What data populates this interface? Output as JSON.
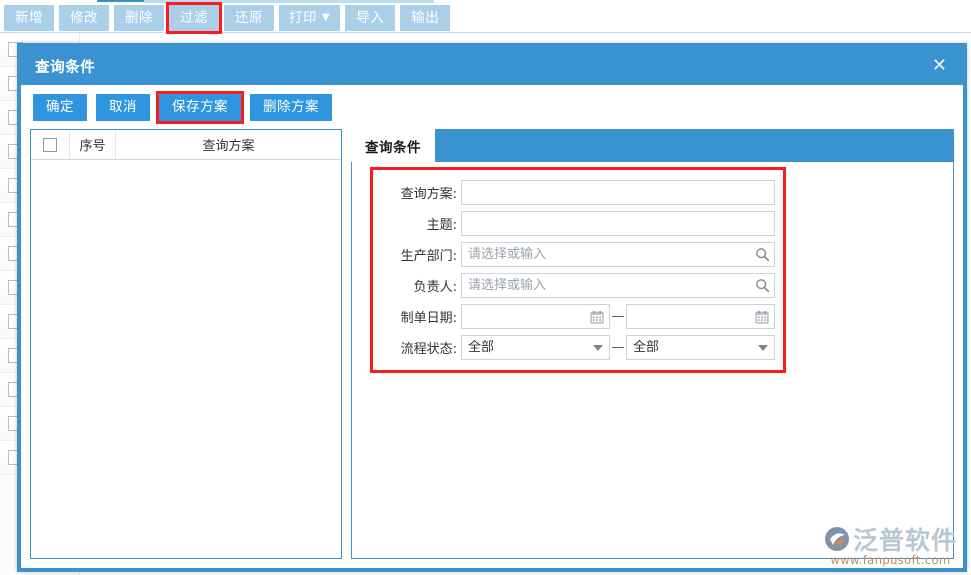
{
  "background": {
    "toolbar": {
      "buttons": [
        {
          "label": "新增",
          "name": "add-button",
          "highlighted": false,
          "caret": false
        },
        {
          "label": "修改",
          "name": "edit-button",
          "highlighted": false,
          "caret": false
        },
        {
          "label": "删除",
          "name": "delete-button",
          "highlighted": false,
          "caret": false
        },
        {
          "label": "过滤",
          "name": "filter-button",
          "highlighted": true,
          "caret": false
        },
        {
          "label": "还原",
          "name": "restore-button",
          "highlighted": false,
          "caret": false
        },
        {
          "label": "打印",
          "name": "print-button",
          "highlighted": false,
          "caret": true
        },
        {
          "label": "导入",
          "name": "import-button",
          "highlighted": false,
          "caret": false
        },
        {
          "label": "输出",
          "name": "export-button",
          "highlighted": false,
          "caret": false
        }
      ]
    },
    "grid_row_count": 13
  },
  "dialog": {
    "title": "查询条件",
    "close_icon": "close-icon",
    "toolbar": [
      {
        "label": "确定",
        "name": "confirm-button",
        "highlighted": false
      },
      {
        "label": "取消",
        "name": "cancel-button",
        "highlighted": false
      },
      {
        "label": "保存方案",
        "name": "save-scheme-button",
        "highlighted": true
      },
      {
        "label": "删除方案",
        "name": "delete-scheme-button",
        "highlighted": false
      }
    ],
    "scheme_table": {
      "columns": [
        "",
        "序号",
        "查询方案"
      ],
      "rows": []
    },
    "tabs": [
      {
        "label": "查询条件",
        "active": true
      }
    ],
    "form": {
      "fields": [
        {
          "type": "text",
          "label": "查询方案:",
          "name": "query-scheme-field",
          "value": "",
          "placeholder": ""
        },
        {
          "type": "text",
          "label": "主题:",
          "name": "subject-field",
          "value": "",
          "placeholder": ""
        },
        {
          "type": "lookup",
          "label": "生产部门:",
          "name": "production-department-field",
          "value": "",
          "placeholder": "请选择或输入",
          "icon": "search-icon"
        },
        {
          "type": "lookup",
          "label": "负责人:",
          "name": "person-in-charge-field",
          "value": "",
          "placeholder": "请选择或输入",
          "icon": "search-icon"
        },
        {
          "type": "date-range",
          "label": "制单日期:",
          "name": "create-date-range",
          "from_value": "",
          "to_value": "",
          "separator": "—",
          "icon": "calendar-icon"
        },
        {
          "type": "select-range",
          "label": "流程状态:",
          "name": "workflow-status-range",
          "from_value": "全部",
          "to_value": "全部",
          "separator": "—",
          "options": [
            "全部"
          ],
          "icon": "chevron-down-icon"
        }
      ]
    }
  },
  "watermark": {
    "brand": "泛普软件",
    "url": "www.fanpusoft.com"
  },
  "colors": {
    "accent": "#3b92d1",
    "toolbar_button": "#a9cfe9",
    "highlight": "#f81c1c",
    "dialog_button": "#2f95de"
  }
}
